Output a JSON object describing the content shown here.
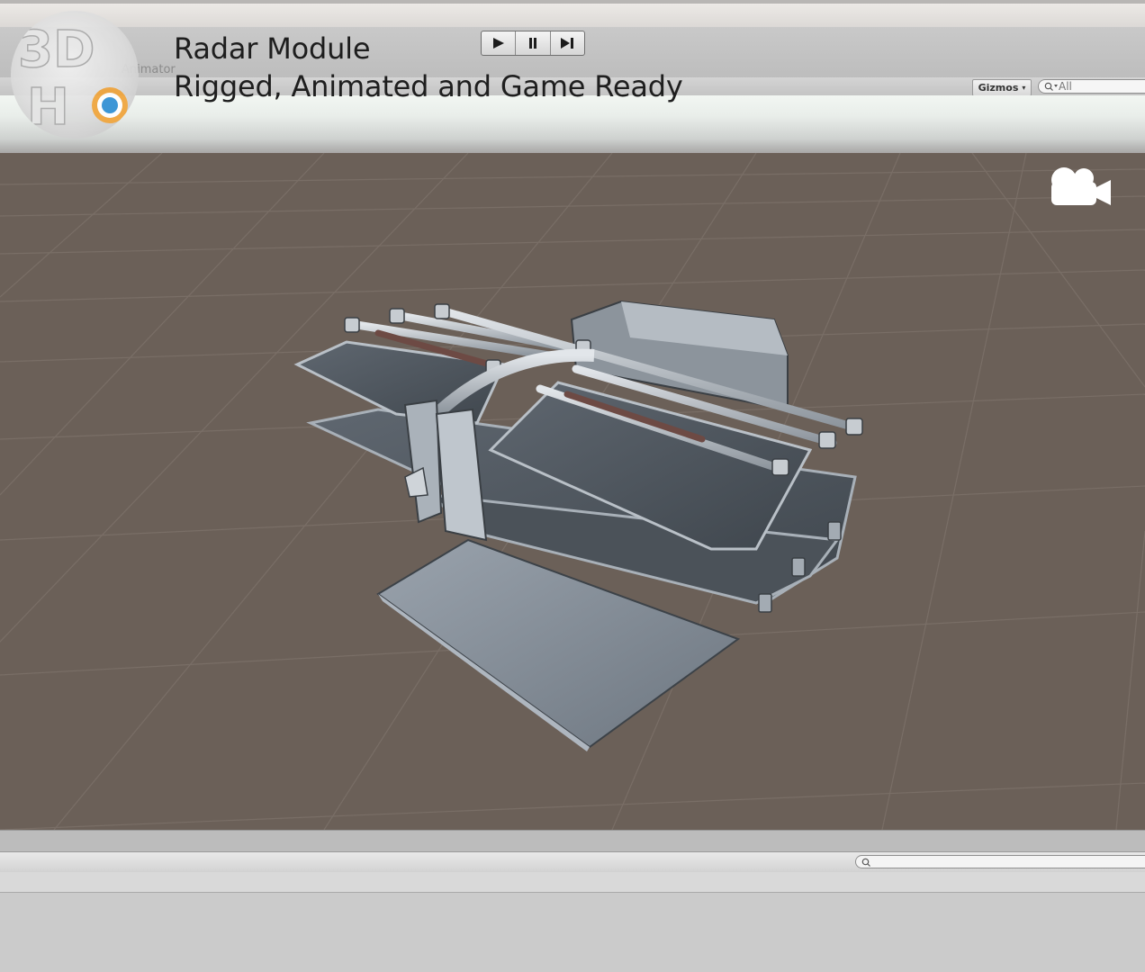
{
  "title": {
    "line1": "Radar Module",
    "line2": "Rigged, Animated and Game Ready"
  },
  "toolbar": {
    "play_icon": "play-icon",
    "pause_icon": "pause-icon",
    "step_icon": "step-icon"
  },
  "scene_header": {
    "gizmos_label": "Gizmos",
    "search_placeholder": "All"
  },
  "ghost_labels": {
    "animator": "Animator"
  },
  "logo": {
    "text": "3DH"
  },
  "colors": {
    "scene_bg": "#6b6058",
    "grid": "#7d7269",
    "panel": "#c8c8c8"
  }
}
